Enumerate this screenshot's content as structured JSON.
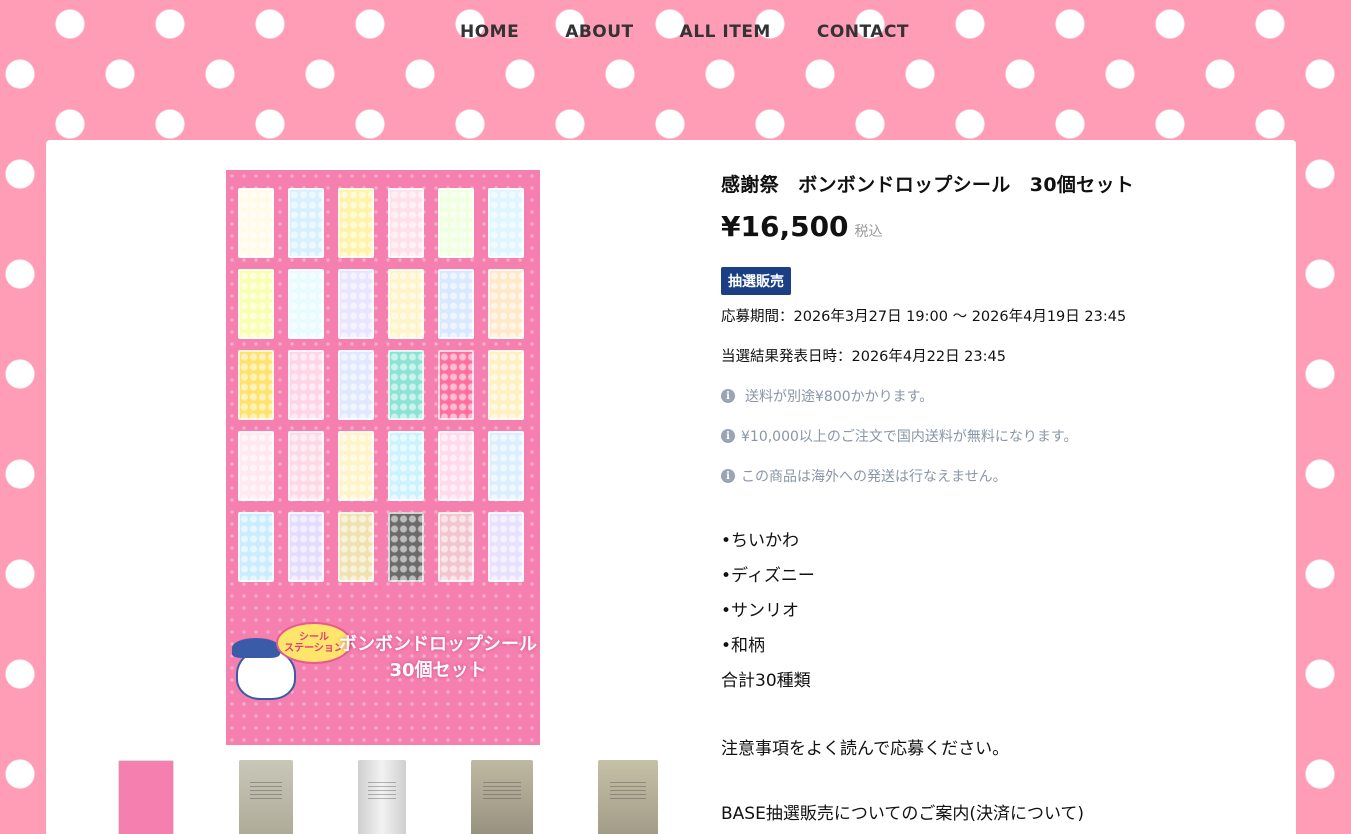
{
  "nav": {
    "items": [
      "HOME",
      "ABOUT",
      "ALL ITEM",
      "CONTACT"
    ]
  },
  "product": {
    "title": "感謝祭　ボンボンドロップシール　30個セット",
    "price": "¥16,500",
    "tax_label": "税込",
    "badge": "抽選販売",
    "application_period": "応募期間：2026年3月27日 19:00 〜 2026年4月19日 23:45",
    "result_date": "当選結果発表日時：2026年4月22日 23:45",
    "notices": [
      "送料が別途¥800かかります。",
      "¥10,000以上のご注文で国内送料が無料になります。",
      "この商品は海外への発送は行なえません。"
    ],
    "description": [
      "•ちいかわ",
      "•ディズニー",
      "•サンリオ",
      "•和柄",
      "合計30種類"
    ],
    "caution": "注意事項をよく読んで応募ください。",
    "more_text": "BASE抽選販売についてのご案内(決済について)"
  },
  "image": {
    "banner_text_line1": "ボンボンドロップシール",
    "banner_text_line2": "30個セット",
    "mascot_text": "シール\nステーション",
    "pack_colors": [
      "#fffbe8",
      "#d7f0ff",
      "#fff3a8",
      "#ffe0ea",
      "#f0ffe0",
      "#dff6ff",
      "#f7ffb0",
      "#e8fbff",
      "#e9e4ff",
      "#fff4c8",
      "#d8e8ff",
      "#ffe8c8",
      "#ffe26b",
      "#ffd4e4",
      "#dfe8ff",
      "#8ce3d4",
      "#ff6f9e",
      "#fff0c0",
      "#ffe8f0",
      "#ffd8e6",
      "#fff4c8",
      "#cbf3ff",
      "#ffdaea",
      "#dbeeff",
      "#c9ecff",
      "#e4dcff",
      "#efe2b0",
      "#6b6b6b",
      "#f2c6cf",
      "#e8e0ff"
    ]
  }
}
